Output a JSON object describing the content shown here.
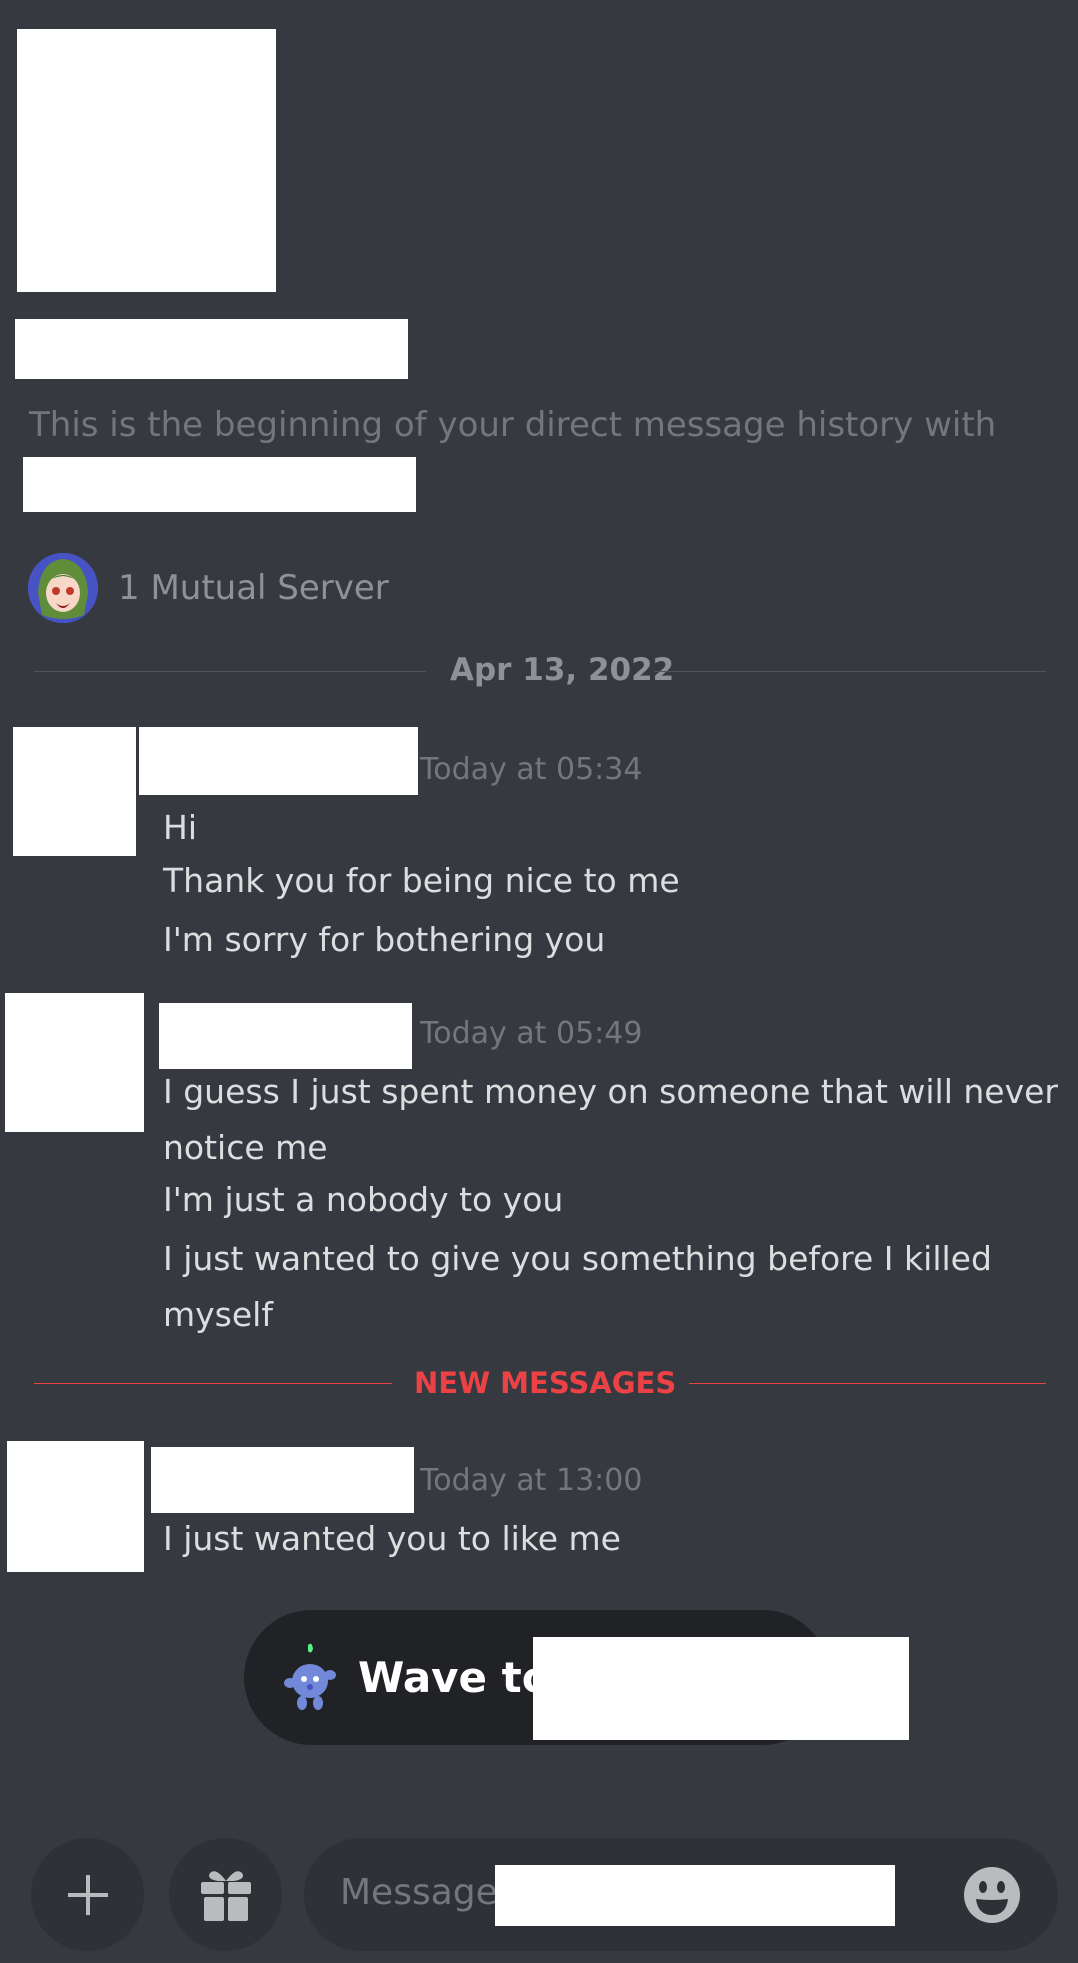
{
  "dm_intro": {
    "text": "This is the beginning of your direct message history with",
    "mutual_servers": "1 Mutual Server"
  },
  "date_divider": "Apr 13, 2022",
  "new_messages_label": "NEW MESSAGES",
  "message_groups": [
    {
      "timestamp": "Today at 05:34",
      "lines": [
        "Hi",
        "Thank you for being nice to me",
        "I'm sorry for bothering you"
      ]
    },
    {
      "timestamp": "Today at 05:49",
      "lines": [
        "I guess I just spent money on someone that will never",
        "notice me",
        "I'm just a nobody to you",
        "I just wanted to give you something before I killed",
        "myself"
      ]
    },
    {
      "timestamp": "Today at 13:00",
      "lines": [
        "I just wanted you to like me"
      ]
    }
  ],
  "wave_button": {
    "label": "Wave to",
    "icon": "wumpus-wave-icon"
  },
  "composer": {
    "placeholder": "Message",
    "buttons": [
      "plus-icon",
      "gift-icon",
      "emoji-icon"
    ]
  },
  "colors": {
    "background": "#36393f",
    "new_messages": "#ed4245",
    "muted_text": "#72767d"
  }
}
